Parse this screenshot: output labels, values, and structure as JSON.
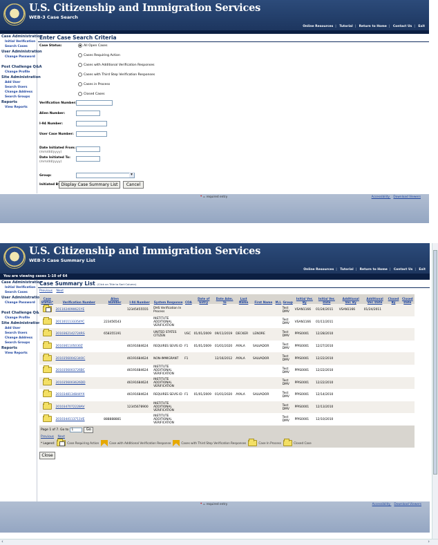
{
  "agency": "U.S. Citizenship and Immigration Services",
  "top_nav": [
    "Online Resources",
    "Tutorial",
    "Return to Home",
    "Contact Us",
    "Exit"
  ],
  "sidebar": [
    {
      "heading": "Case Administration",
      "items": [
        "Initial Verification",
        "Search Cases"
      ]
    },
    {
      "heading": "User Administration",
      "items": [
        "Change Password"
      ]
    },
    {
      "heading": "Post Challenge Q&A",
      "items": [
        "Change Profile"
      ]
    },
    {
      "heading": "Site Administration",
      "items": [
        "Add User",
        "Search Users",
        "Change Address",
        "Search Groups"
      ]
    },
    {
      "heading": "Reports",
      "items": [
        "View Reports"
      ]
    }
  ],
  "screen1": {
    "subtitle": "WEB-3 Case Search",
    "section_title": "Enter Case Search Criteria",
    "case_status_label": "Case Status:",
    "case_status_options": [
      "All Open Cases",
      "Cases Requiring Action",
      "Cases with Additional Verification Responses",
      "Cases with Third Step Verification Responses",
      "Cases in Process",
      "Closed Cases"
    ],
    "selected_status": "All Open Cases",
    "fields": {
      "verification_number": "Verification Number:",
      "alien_number": "Alien Number:",
      "i94_number": "I-94 Number:",
      "user_case_number": "User Case Number:",
      "date_from": "Date Initiated From:",
      "date_from_hint": "(mm/dd/yyyy)",
      "date_to": "Date Initiated To:",
      "date_to_hint": "(mm/dd/yyyy)",
      "group": "Group:",
      "initiated_by": "Initiated By:"
    },
    "display_button": "Display Case Summary List",
    "cancel_button": "Cancel"
  },
  "screen2": {
    "subtitle": "WEB-3 Case Summary List",
    "viewing": "You are viewing cases 1-10 of 64",
    "section_title": "Case Summary List",
    "section_hint": "(Click on Title to Sort Column)",
    "prev": "Previous",
    "next": "Next",
    "columns": [
      "Case Status*",
      "Verification Number",
      "Alien Number",
      "I-94 Number",
      "System Response",
      "COA",
      "Date of Entry",
      "Date Adm. To",
      "Last Name",
      "First Name",
      "M.I.",
      "Group",
      "Initial Ver. By",
      "Initial Ver. Date",
      "Additional Ver. By",
      "Additional Ver. Date",
      "Closed By",
      "Closed Date"
    ],
    "rows": [
      {
        "vn": "2011024090621YE",
        "alien": "",
        "i94": "12345455555",
        "resp": "DHS Verification In Process",
        "coa": "",
        "doe": "",
        "dat": "",
        "last": "",
        "first": "",
        "mi": "",
        "group": "Test DMV",
        "ivby": "VSAN1166",
        "ivdate": "01/24/2011",
        "avby": "VSAN1166",
        "avdate": "01/24/2011",
        "cby": "",
        "cdate": "",
        "icon": "req"
      },
      {
        "vn": "2011011133354YC",
        "alien": "223456543",
        "i94": "",
        "resp": "INSTITUTE ADDITIONAL VERIFICATION",
        "coa": "",
        "doe": "",
        "dat": "",
        "last": "",
        "first": "",
        "mi": "",
        "group": "Test DMV",
        "ivby": "VSAN1166",
        "ivdate": "01/11/2011",
        "avby": "",
        "avdate": "",
        "cby": "",
        "cdate": "",
        "icon": "folder"
      },
      {
        "vn": "2010362142724RS",
        "alien": "658355191",
        "i94": "",
        "resp": "UNITED STATES CITIZEN",
        "coa": "USC",
        "doe": "01/01/2009",
        "dat": "09/11/2019",
        "last": "DECKER",
        "first": "LENORE",
        "mi": "",
        "group": "Test DMV",
        "ivby": "PPIS0001",
        "ivdate": "12/28/2010",
        "avby": "",
        "avdate": "",
        "cby": "",
        "cdate": "",
        "icon": "folder"
      },
      {
        "vn": "2010361105030Z",
        "alien": "",
        "i94": "46191684624",
        "resp": "REQUIRES SEVIS ID",
        "coa": "F1",
        "doe": "01/01/2009",
        "dat": "01/01/2020",
        "last": "AYALA",
        "first": "SALVADOR",
        "mi": "",
        "group": "Test DMV",
        "ivby": "PPIS0001",
        "ivdate": "12/27/2010",
        "avby": "",
        "avdate": "",
        "cby": "",
        "cdate": "",
        "icon": "folder"
      },
      {
        "vn": "2010356004234OC",
        "alien": "",
        "i94": "46191684624",
        "resp": "NON-IMMIGRANT",
        "coa": "F1",
        "doe": "",
        "dat": "12/16/2012",
        "last": "AYALA",
        "first": "SALVADOR",
        "mi": "",
        "group": "Test DMV",
        "ivby": "PPIS0001",
        "ivdate": "12/22/2010",
        "avby": "",
        "avdate": "",
        "cby": "",
        "cdate": "",
        "icon": "folder"
      },
      {
        "vn": "2010356003726BC",
        "alien": "",
        "i94": "46191684624",
        "resp": "INSTITUTE ADDITIONAL VERIFICATION",
        "coa": "",
        "doe": "",
        "dat": "",
        "last": "",
        "first": "",
        "mi": "",
        "group": "Test DMV",
        "ivby": "PPIS0001",
        "ivdate": "12/22/2010",
        "avby": "",
        "avdate": "",
        "cby": "",
        "cdate": "",
        "icon": "folder"
      },
      {
        "vn": "2010356003626DD",
        "alien": "",
        "i94": "46191684624",
        "resp": "INSTITUTE ADDITIONAL VERIFICATION",
        "coa": "",
        "doe": "",
        "dat": "",
        "last": "",
        "first": "",
        "mi": "",
        "group": "Test DMV",
        "ivby": "PPIS0001",
        "ivdate": "12/22/2010",
        "avby": "",
        "avdate": "",
        "cby": "",
        "cdate": "",
        "icon": "folder"
      },
      {
        "vn": "2010348134844YX",
        "alien": "",
        "i94": "46191684624",
        "resp": "REQUIRES SEVIS ID",
        "coa": "F1",
        "doe": "01/01/2009",
        "dat": "01/01/2020",
        "last": "AYALA",
        "first": "SALVADOR",
        "mi": "",
        "group": "Test DMV",
        "ivby": "PPIS0001",
        "ivdate": "12/14/2010",
        "avby": "",
        "avdate": "",
        "cby": "",
        "cdate": "",
        "icon": "folder"
      },
      {
        "vn": "2010347072228AV",
        "alien": "",
        "i94": "12345678900",
        "resp": "INSTITUTE ADDITIONAL VERIFICATION",
        "coa": "",
        "doe": "",
        "dat": "",
        "last": "",
        "first": "",
        "mi": "",
        "group": "Test DMV",
        "ivby": "PPIS0001",
        "ivdate": "12/13/2010",
        "avby": "",
        "avdate": "",
        "cby": "",
        "cdate": "",
        "icon": "folder"
      },
      {
        "vn": "2010344113711VE",
        "alien": "888888881",
        "i94": "",
        "resp": "INSTITUTE ADDITIONAL VERIFICATION",
        "coa": "",
        "doe": "",
        "dat": "",
        "last": "",
        "first": "",
        "mi": "",
        "group": "Test DMV",
        "ivby": "PPIS0001",
        "ivdate": "12/10/2010",
        "avby": "",
        "avdate": "",
        "cby": "",
        "cdate": "",
        "icon": "folder"
      }
    ],
    "page_label_pre": "Page 1 of 7. Go to",
    "page_value": "1",
    "go_button": "Go",
    "legend_label": "* Legend:",
    "legend": [
      "Case Requiring Action",
      "Case with Additional Verification Response",
      "Cases with Third Step Verification Responses",
      "Case In Process",
      "Closed Case"
    ],
    "close_button": "Close"
  },
  "footer": {
    "required_mark": "*",
    "required_text": " = required entry",
    "links": [
      "Accessibility",
      "Download Viewers"
    ]
  }
}
